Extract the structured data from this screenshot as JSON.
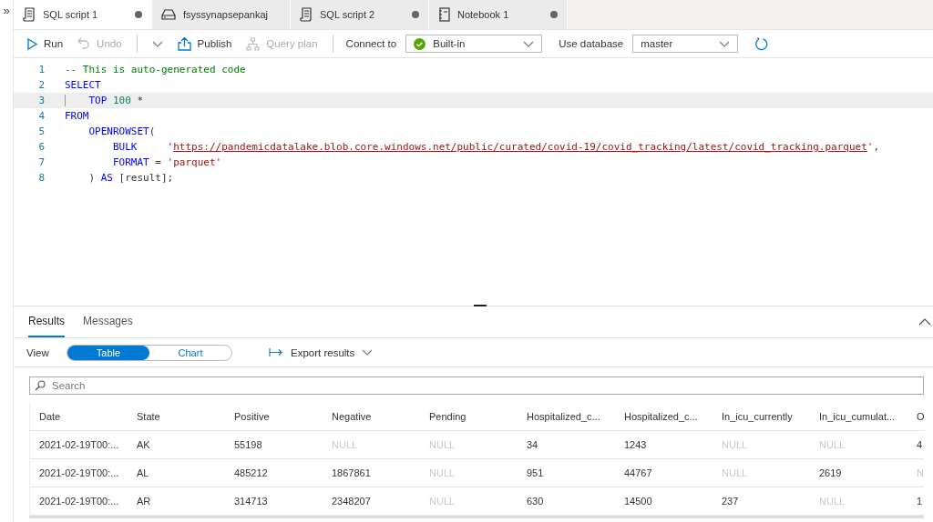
{
  "sidebar_toggle": "»",
  "tabs": [
    {
      "label": "SQL script 1",
      "kind": "script",
      "selected": true,
      "modified": true
    },
    {
      "label": "fsyssynapsepankaj",
      "kind": "pool",
      "selected": false,
      "modified": false
    },
    {
      "label": "SQL script 2",
      "kind": "script",
      "selected": false,
      "modified": true
    },
    {
      "label": "Notebook 1",
      "kind": "notebook",
      "selected": false,
      "modified": true
    }
  ],
  "toolbar": {
    "buttons": [
      {
        "label": "Run",
        "kind": "run",
        "disabled": false
      },
      {
        "label": "Undo",
        "kind": "undo",
        "disabled": true
      },
      {
        "label": "Publish",
        "kind": "publish",
        "disabled": false
      },
      {
        "label": "Query plan",
        "kind": "plan",
        "disabled": true
      }
    ],
    "connect_label": "Connect to",
    "connect_value": "Built-in",
    "database_label": "Use database",
    "database_value": "master"
  },
  "editor": {
    "lines": [
      {
        "number": "1",
        "current": false,
        "tokens": [
          {
            "text": "-- This is auto-generated code",
            "kind": "comment"
          }
        ]
      },
      {
        "number": "2",
        "current": false,
        "tokens": [
          {
            "text": "SELECT",
            "kind": "keyword"
          }
        ]
      },
      {
        "number": "3",
        "current": true,
        "tokens": [
          {
            "text": "    TOP",
            "kind": "keyword"
          },
          {
            "text": " 100",
            "kind": "number"
          },
          {
            "text": " *",
            "kind": "plain"
          }
        ]
      },
      {
        "number": "4",
        "current": false,
        "tokens": [
          {
            "text": "FROM",
            "kind": "keyword"
          }
        ]
      },
      {
        "number": "5",
        "current": false,
        "tokens": [
          {
            "text": "    OPENROWSET",
            "kind": "keyword"
          },
          {
            "text": "(",
            "kind": "plain"
          }
        ]
      },
      {
        "number": "6",
        "current": false,
        "tokens": [
          {
            "text": "        BULK",
            "kind": "keyword"
          },
          {
            "text": "     '",
            "kind": "string"
          },
          {
            "text": "https://pandemicdatalake.blob.core.windows.net/public/curated/covid-19/covid_tracking/latest/covid_tracking.parquet",
            "kind": "link"
          },
          {
            "text": "'",
            "kind": "string"
          },
          {
            "text": ",",
            "kind": "plain"
          }
        ]
      },
      {
        "number": "7",
        "current": false,
        "tokens": [
          {
            "text": "        FORMAT",
            "kind": "keyword"
          },
          {
            "text": " = ",
            "kind": "plain"
          },
          {
            "text": "'parquet'",
            "kind": "string"
          }
        ]
      },
      {
        "number": "8",
        "current": false,
        "tokens": [
          {
            "text": "    ) ",
            "kind": "plain"
          },
          {
            "text": "AS",
            "kind": "keyword"
          },
          {
            "text": " [result];",
            "kind": "plain"
          }
        ]
      }
    ]
  },
  "results": {
    "tabs": [
      {
        "label": "Results",
        "selected": true
      },
      {
        "label": "Messages",
        "selected": false
      }
    ],
    "view_label": "View",
    "view_options": [
      {
        "label": "Table",
        "selected": true
      },
      {
        "label": "Chart",
        "selected": false
      }
    ],
    "export_label": "Export results",
    "search": {
      "placeholder": "Search"
    },
    "table": {
      "columns": [
        "Date",
        "State",
        "Positive",
        "Negative",
        "Pending",
        "Hospitalized_c...",
        "Hospitalized_c...",
        "In_icu_currently",
        "In_icu_cumulat...",
        "O"
      ],
      "rows": [
        [
          {
            "text": "2021-02-19T00:...",
            "muted": false
          },
          {
            "text": "AK",
            "muted": false
          },
          {
            "text": "55198",
            "muted": false
          },
          {
            "text": "NULL",
            "muted": true
          },
          {
            "text": "NULL",
            "muted": true
          },
          {
            "text": "34",
            "muted": false
          },
          {
            "text": "1243",
            "muted": false
          },
          {
            "text": "NULL",
            "muted": true
          },
          {
            "text": "NULL",
            "muted": true
          },
          {
            "text": "4",
            "muted": false
          }
        ],
        [
          {
            "text": "2021-02-19T00:...",
            "muted": false
          },
          {
            "text": "AL",
            "muted": false
          },
          {
            "text": "485212",
            "muted": false
          },
          {
            "text": "1867861",
            "muted": false
          },
          {
            "text": "NULL",
            "muted": true
          },
          {
            "text": "951",
            "muted": false
          },
          {
            "text": "44767",
            "muted": false
          },
          {
            "text": "NULL",
            "muted": true
          },
          {
            "text": "2619",
            "muted": false
          },
          {
            "text": "N",
            "muted": true
          }
        ],
        [
          {
            "text": "2021-02-19T00:...",
            "muted": false
          },
          {
            "text": "AR",
            "muted": false
          },
          {
            "text": "314713",
            "muted": false
          },
          {
            "text": "2348207",
            "muted": false
          },
          {
            "text": "NULL",
            "muted": true
          },
          {
            "text": "630",
            "muted": false
          },
          {
            "text": "14500",
            "muted": false
          },
          {
            "text": "237",
            "muted": false
          },
          {
            "text": "NULL",
            "muted": true
          },
          {
            "text": "1",
            "muted": false
          }
        ]
      ]
    }
  }
}
